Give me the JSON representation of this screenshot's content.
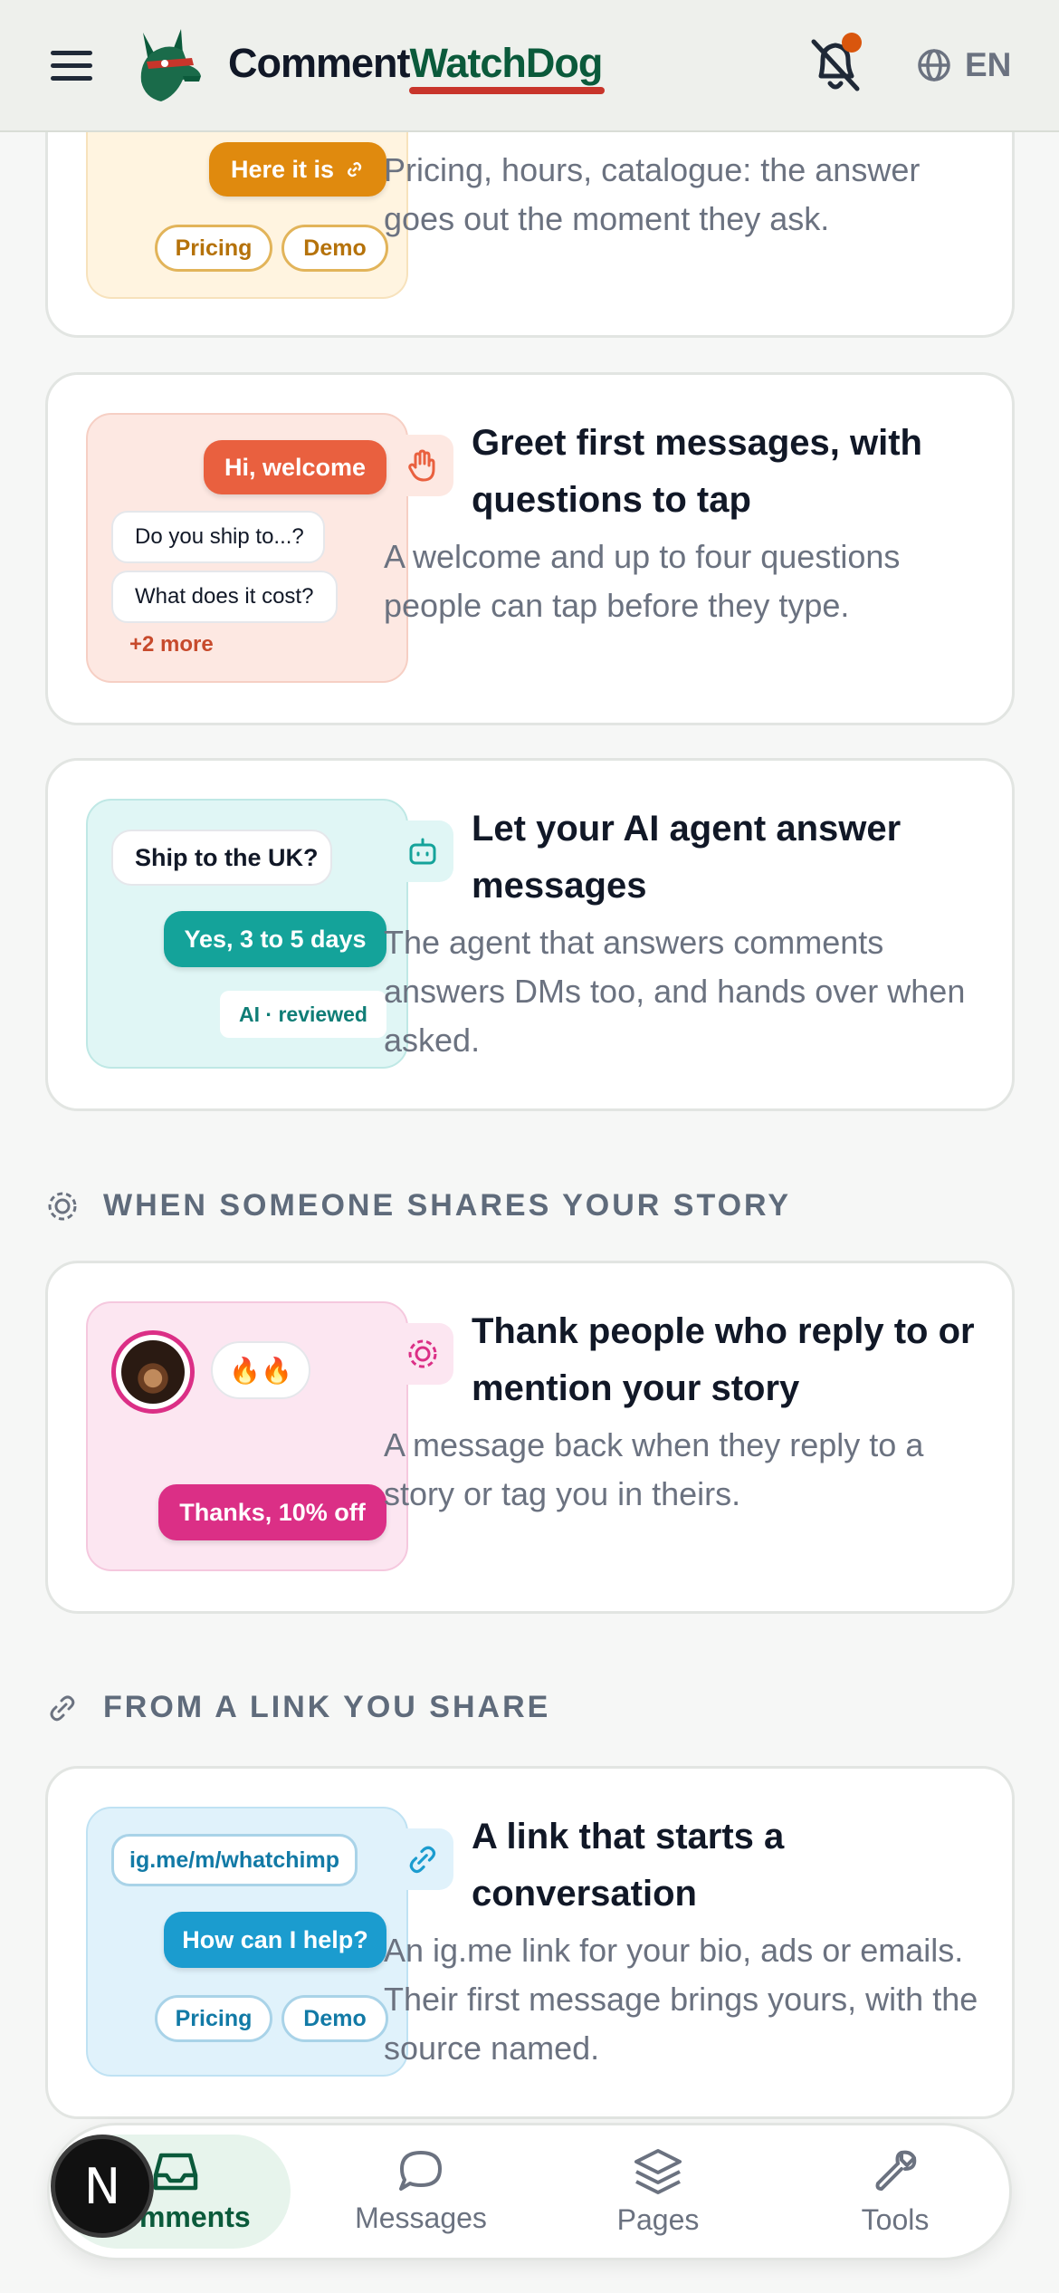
{
  "header": {
    "brand_part1": "Comment",
    "brand_part2": "WatchDog",
    "language": "EN"
  },
  "cards": [
    {
      "title": "",
      "description": "Pricing, hours, catalogue: the answer goes out the moment they ask.",
      "illustration": {
        "reply": "Here it is",
        "chips": [
          "Pricing",
          "Demo"
        ]
      }
    },
    {
      "title": "Greet first messages, with questions to tap",
      "description": "A welcome and up to four questions people can tap before they type.",
      "illustration": {
        "reply": "Hi, welcome",
        "questions": [
          "Do you ship to...?",
          "What does it cost?"
        ],
        "more": "+2 more"
      }
    },
    {
      "title": "Let your AI agent answer messages",
      "description": "The agent that answers comments answers DMs too, and hands over when asked.",
      "illustration": {
        "question": "Ship to the UK?",
        "reply": "Yes, 3 to 5 days",
        "tag": "AI · reviewed"
      }
    },
    {
      "title": "Thank people who reply to or mention your story",
      "description": "A message back when they reply to a story or tag you in theirs.",
      "illustration": {
        "reaction": "🔥🔥",
        "reply": "Thanks, 10% off"
      }
    },
    {
      "title": "A link that starts a conversation",
      "description": "An ig.me link for your bio, ads or emails. Their first message brings yours, with the source named.",
      "illustration": {
        "link": "ig.me/m/whatchimp",
        "reply": "How can I help?",
        "chips": [
          "Pricing",
          "Demo"
        ]
      }
    }
  ],
  "sections": {
    "story": "WHEN SOMEONE SHARES YOUR STORY",
    "link": "FROM A LINK YOU SHARE"
  },
  "nav": {
    "items": [
      "Comments",
      "Messages",
      "Pages",
      "Tools"
    ],
    "active": "Comments"
  },
  "badge_letter": "N",
  "colors": {
    "accent_green": "#0b5a3b",
    "orange": "#e08a0e",
    "coral": "#e9603f",
    "teal": "#14a39a",
    "pink": "#db2f86",
    "blue": "#1b9ccf"
  },
  "icons": {
    "menu": "hamburger-icon",
    "bell": "bell-off-icon",
    "language": "globe-icon"
  }
}
